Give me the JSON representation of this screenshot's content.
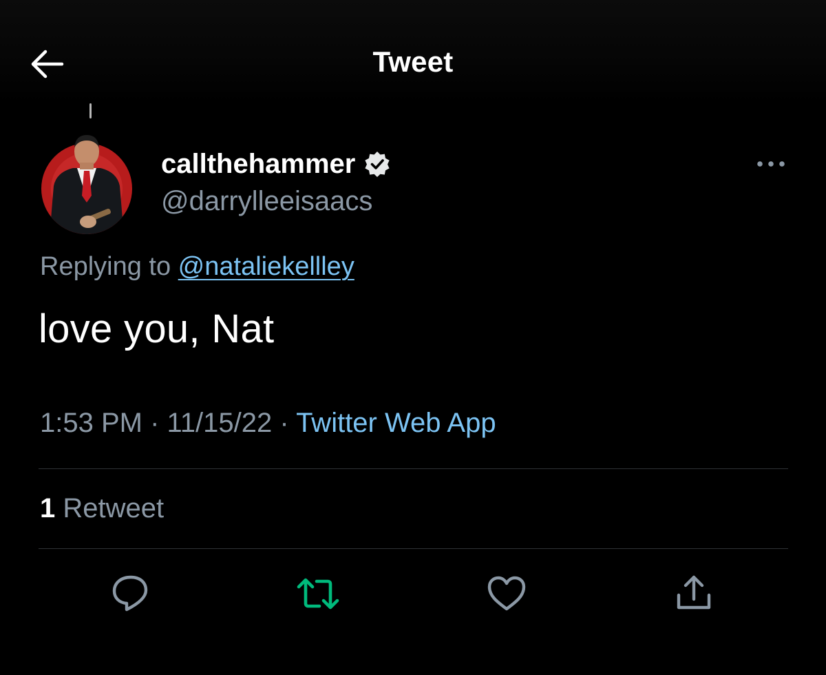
{
  "header": {
    "title": "Tweet",
    "back_icon": "arrow-left-icon"
  },
  "author": {
    "display_name": "callthehammer",
    "handle": "@darrylleeisaacs",
    "verified": true,
    "verified_icon": "verified-badge-icon"
  },
  "reply": {
    "prefix": "Replying to ",
    "to_handle": "@nataliekellley"
  },
  "tweet": {
    "text": "love you, Nat"
  },
  "meta": {
    "time": "1:53 PM",
    "separator": " · ",
    "date": "11/15/22",
    "source": "Twitter Web App"
  },
  "stats": {
    "retweet_count": "1",
    "retweet_label": " Retweet"
  },
  "actions": [
    {
      "name": "reply",
      "icon": "reply-icon"
    },
    {
      "name": "retweet",
      "icon": "retweet-icon"
    },
    {
      "name": "like",
      "icon": "heart-icon"
    },
    {
      "name": "share",
      "icon": "share-icon"
    }
  ],
  "colors": {
    "background": "#000000",
    "text_primary": "#ffffff",
    "text_secondary": "#8b98a5",
    "link": "#7cc3f3",
    "retweeted": "#00ba7c",
    "divider": "#2f3336"
  }
}
